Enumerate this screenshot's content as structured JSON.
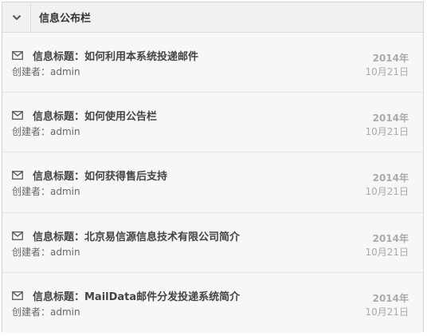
{
  "panel": {
    "title": "信息公布栏",
    "collapse_icon": "chevron-down-icon"
  },
  "items": [
    {
      "title": "信息标题：如何利用本系统投递邮件",
      "creator": "创建者：admin",
      "year": "2014年",
      "month_day": "10月21日",
      "icon": "mail-icon"
    },
    {
      "title": "信息标题：如何使用公告栏",
      "creator": "创建者：admin",
      "year": "2014年",
      "month_day": "10月21日",
      "icon": "mail-icon"
    },
    {
      "title": "信息标题：如何获得售后支持",
      "creator": "创建者：admin",
      "year": "2014年",
      "month_day": "10月21日",
      "icon": "mail-icon"
    },
    {
      "title": "信息标题：北京易信源信息技术有限公司简介",
      "creator": "创建者：admin",
      "year": "2014年",
      "month_day": "10月21日",
      "icon": "mail-icon"
    },
    {
      "title": "信息标题：MailData邮件分发投递系统简介",
      "creator": "创建者：admin",
      "year": "2014年",
      "month_day": "10月21日",
      "icon": "mail-icon"
    }
  ]
}
